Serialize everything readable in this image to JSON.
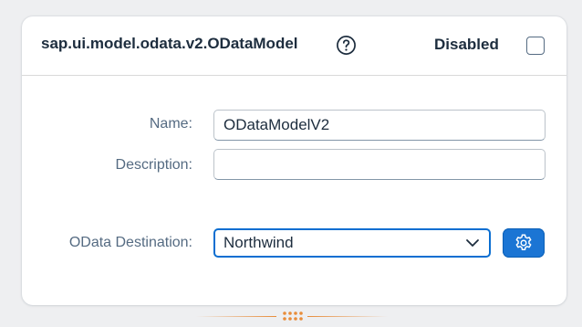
{
  "header": {
    "title": "sap.ui.model.odata.v2.ODataModel",
    "disabled_label": "Disabled",
    "disabled_checked": false
  },
  "form": {
    "name_label": "Name:",
    "name_value": "ODataModelV2",
    "description_label": "Description:",
    "description_value": "",
    "destination_label": "OData Destination:",
    "destination_selected": "Northwind"
  },
  "icons": {
    "help": "question-mark-circle-icon",
    "chevron": "chevron-down-icon",
    "settings": "gear-icon",
    "grip": "drag-grip-icon"
  },
  "colors": {
    "accent": "#0a6ed1",
    "button": "#1b75d4",
    "handle": "#e88c3a",
    "label": "#556b82",
    "text": "#1d2d3e"
  }
}
